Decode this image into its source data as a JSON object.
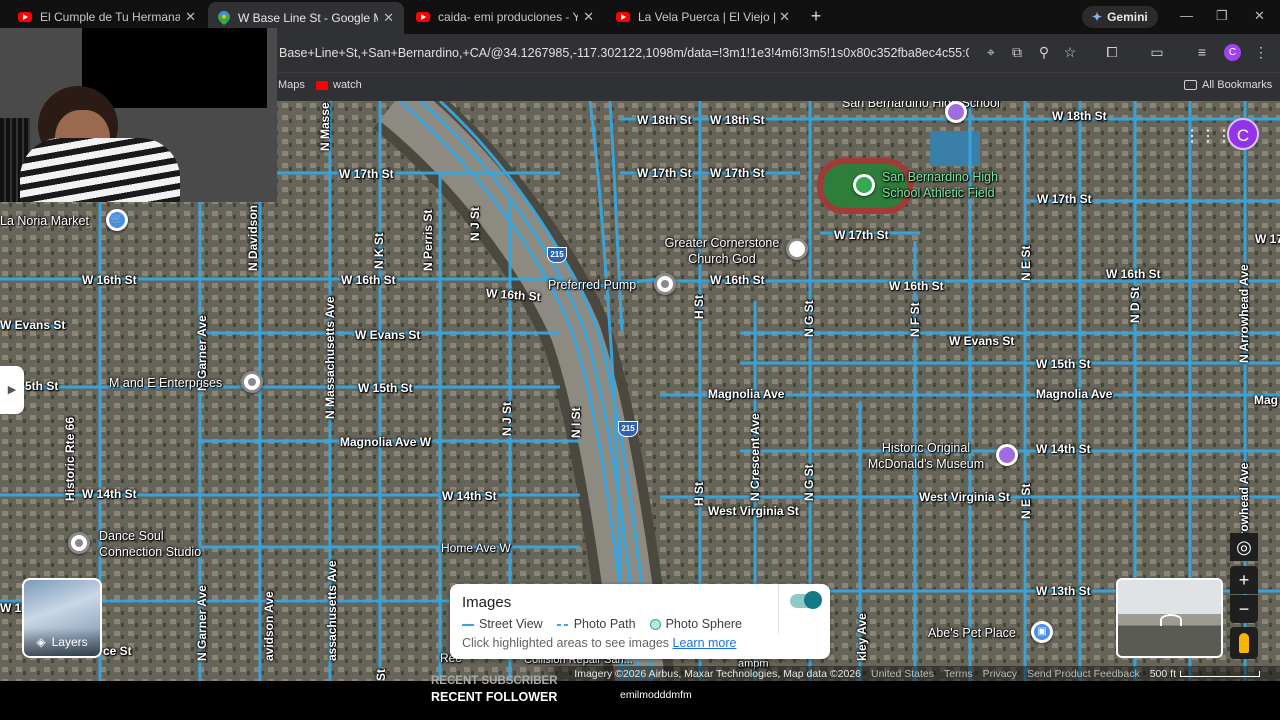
{
  "tabs": [
    {
      "title": "El Cumple de Tu Hermana - You",
      "icon": "youtube-icon"
    },
    {
      "title": "W Base Line St - Google Maps",
      "icon": "maps-icon",
      "active": true
    },
    {
      "title": "caida- emi produciones - YouTu",
      "icon": "youtube-icon"
    },
    {
      "title": "La Vela Puerca | El Viejo | De Bi",
      "icon": "youtube-icon"
    }
  ],
  "gemini_label": "Gemini",
  "address_bar": {
    "url": "Base+Line+St,+San+Bernardino,+CA/@34.1267985,-117.302122,1098m/data=!3m1!1e3!4m6!3m5!1s0x80c352fba8ec4c55:0x6f51354..."
  },
  "profile_initial": "C",
  "bookmarks": {
    "items": [
      "Maps",
      "watch"
    ],
    "all_bookmarks": "All Bookmarks"
  },
  "map": {
    "street_labels": [
      "W 18th St",
      "W 18th St",
      "W 18th St",
      "W 17th St",
      "W 17th St",
      "W 17th St",
      "W 17th St",
      "W 17th St",
      "W 17",
      "W 16th St",
      "W 16th St",
      "W 16th St",
      "W 16th St",
      "W 16th St",
      "W 16th St",
      "W Evans St",
      "W Evans St",
      "W Evans St",
      "5th St",
      "W 15th St",
      "W 15th St",
      "Magnolia Ave W",
      "Magnolia Ave",
      "Magnolia Ave",
      "Mag",
      "W 14th St",
      "W 14th St",
      "W 14th St",
      "West Virginia St",
      "West Virginia St",
      "Home Ave W",
      "W 13th St",
      "W 1",
      "ce St",
      "Rec"
    ],
    "vertical_labels": [
      "N Masse",
      "N Davidson",
      "N K St",
      "N Perris St",
      "N J St",
      "N Garner Ave",
      "N Massachusetts Ave",
      "N J St",
      "N I St",
      "Historic Rte 66",
      "H St",
      "N G St",
      "N F St",
      "N E St",
      "N D St",
      "N Arrowhead Ave",
      "N Crescent Ave",
      "H St",
      "N G St",
      "N E St",
      "rrowhead Ave",
      "N Garner Ave",
      "avidson Ave",
      "assachusetts Ave",
      "kley Ave",
      "St"
    ],
    "places": [
      "San Bernardino High School",
      "San Bernardino High School Athletic Field",
      "Greater Cornerstone Church God",
      "Preferred Pump",
      "La Noria Market",
      "M and E Enterprises",
      "Historic Original McDonald's Museum",
      "Dance Soul Connection Studio",
      "Abe's Pet Place",
      "Collision Repair San...",
      "ampm"
    ],
    "highway_shield": "215"
  },
  "images_panel": {
    "title": "Images",
    "legend": [
      "Street View",
      "Photo Path",
      "Photo Sphere"
    ],
    "hint": "Click highlighted areas to see images",
    "learn_more": "Learn more",
    "toggle_on": true
  },
  "layers_label": "Layers",
  "attribution": {
    "imagery": "Imagery ©2026 Airbus, Maxar Technologies, Map data ©2026",
    "links": [
      "United States",
      "Terms",
      "Privacy",
      "Send Product Feedback"
    ],
    "scale": "500 ft"
  },
  "overlay": {
    "recent_subscriber": "RECENT SUBSCRIBER",
    "recent_follower": "RECENT FOLLOWER",
    "follower_name": "emilmodddmfm"
  },
  "colors": {
    "street_view_blue": "#36a7e0",
    "chrome_dark": "#1f1f1f",
    "profile_purple": "#a142f4"
  }
}
